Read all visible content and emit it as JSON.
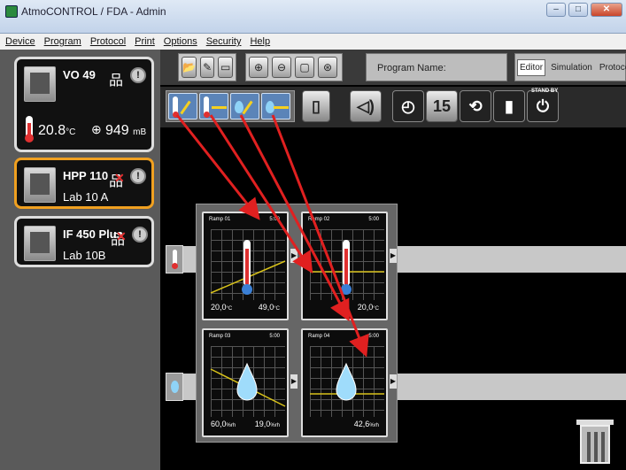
{
  "window": {
    "title": "AtmoCONTROL / FDA - Admin",
    "controls": [
      "–",
      "□",
      "✕"
    ]
  },
  "menu": [
    "Device",
    "Program",
    "Protocol",
    "Print",
    "Options",
    "Security",
    "Help"
  ],
  "devices": [
    {
      "name": "VO 49",
      "temp": "20.8",
      "temp_unit": "°C",
      "pressure": "949",
      "pressure_unit": "mB",
      "connected": true
    },
    {
      "name": "HPP 110",
      "location": "Lab 10 A",
      "connected": false,
      "selected": true
    },
    {
      "name": "IF 450 Plus",
      "location": "Lab 10B",
      "connected": false
    }
  ],
  "toolbar": {
    "program_name_label": "Program Name:",
    "modes": [
      "Editor",
      "Simulation",
      "Protocol"
    ],
    "active_mode": "Editor",
    "zoom_buttons": [
      "⊕",
      "⊖",
      "▢",
      "⊛"
    ],
    "standby_label": "STAND BY",
    "calendar_day": "15"
  },
  "segments": [
    {
      "title": "Ramp 01",
      "time": "5:00",
      "v1": "20,0",
      "v1_unit": "°C",
      "v2": "49,0",
      "v2_unit": "°C",
      "kind": "temp"
    },
    {
      "title": "Ramp 02",
      "time": "5:00",
      "v1": "",
      "v2": "20,0",
      "v2_unit": "°C",
      "kind": "temp"
    },
    {
      "title": "Ramp 03",
      "time": "5:00",
      "v1": "60,0",
      "v1_unit": "%rh",
      "v2": "19,0",
      "v2_unit": "%rh",
      "kind": "humidity"
    },
    {
      "title": "Ramp 04",
      "time": "5:00",
      "v1": "",
      "v2": "42,6",
      "v2_unit": "%rh",
      "kind": "humidity"
    }
  ],
  "colors": {
    "accent_selected": "#f0a020",
    "arrow": "#e02020",
    "ramp_line": "#d8c21a"
  }
}
